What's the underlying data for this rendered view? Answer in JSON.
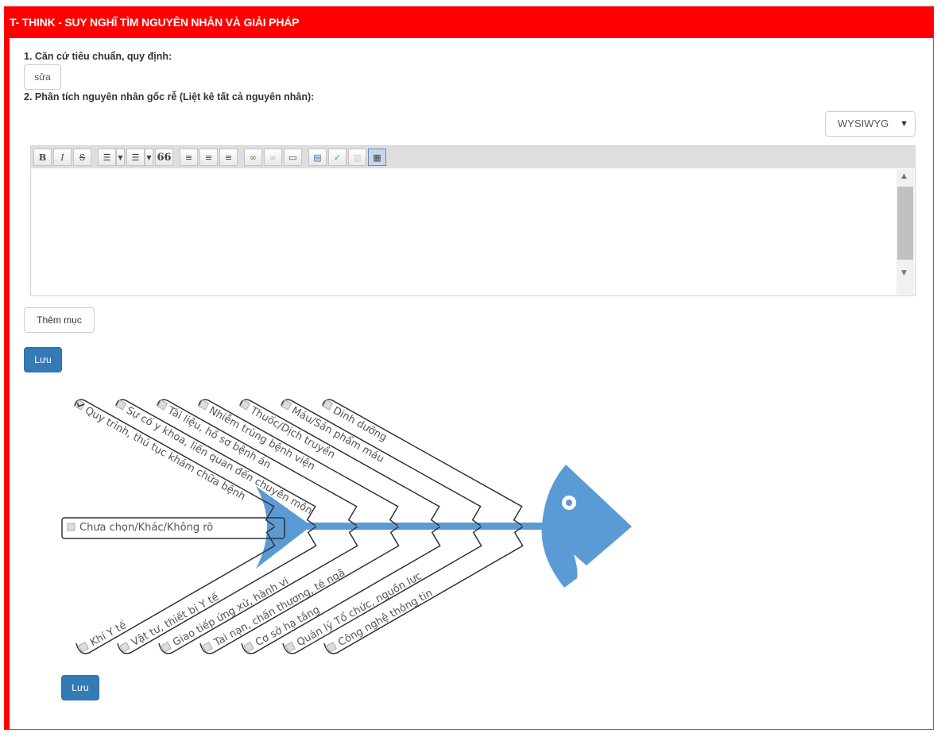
{
  "header": {
    "title": "T- THINK - SUY NGHĨ TÌM NGUYÊN NHÂN VÀ GIẢI PHÁP"
  },
  "section1": {
    "label": "1. Căn cứ tiêu chuẩn, quy định:",
    "edit_button": "sửa"
  },
  "section2": {
    "label": "2. Phân tích nguyên nhân gốc rễ (Liệt kê tất cả nguyên nhân):"
  },
  "editor_mode": {
    "selected": "WYSIWYG"
  },
  "toolbar": {
    "bold": "B",
    "italic": "I",
    "strike": "S",
    "quote": "66"
  },
  "editor": {
    "content": ""
  },
  "buttons": {
    "add_item": "Thêm mục",
    "save": "Lưu",
    "save2": "Lưu"
  },
  "fishbone": {
    "color": "#5b9bd5",
    "top": [
      {
        "label": "Quy trình, thủ tục khám chữa bệnh",
        "checked": true
      },
      {
        "label": "Sự cố y khoa, liên quan đến chuyên môn",
        "checked": false
      },
      {
        "label": "Tài liệu, hồ sơ bệnh án",
        "checked": false
      },
      {
        "label": "Nhiễm trùng bệnh viện",
        "checked": false
      },
      {
        "label": "Thuốc/Dịch truyền",
        "checked": false
      },
      {
        "label": "Máu/Sản phẩm máu",
        "checked": false
      },
      {
        "label": "Dinh dưỡng",
        "checked": false
      }
    ],
    "bottom": [
      {
        "label": "Khí Y tế",
        "checked": false
      },
      {
        "label": "Vật tư, thiết bị Y tế",
        "checked": false
      },
      {
        "label": "Giao tiếp ứng xử, hành vi",
        "checked": false
      },
      {
        "label": "Tai nạn, chấn thương, té ngã",
        "checked": false
      },
      {
        "label": "Cơ sở hạ tầng",
        "checked": false
      },
      {
        "label": "Quản lý Tổ chức, nguồn lực",
        "checked": false
      },
      {
        "label": "Công nghệ thông tin",
        "checked": false
      }
    ],
    "other": {
      "label": "Chưa chọn/Khác/Không rõ",
      "checked": false
    }
  }
}
